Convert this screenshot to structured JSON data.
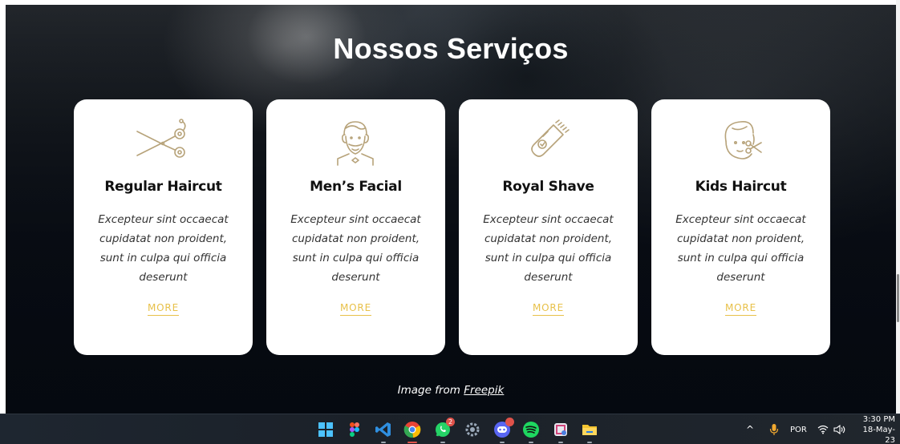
{
  "section": {
    "title": "Nossos Serviços"
  },
  "cards": [
    {
      "icon": "scissors-icon",
      "title": "Regular Haircut",
      "text": "Excepteur sint occaecat cupidatat non proident, sunt in culpa qui officia deserunt",
      "more": "MORE"
    },
    {
      "icon": "bearded-man-icon",
      "title": "Men’s Facial",
      "text": "Excepteur sint occaecat cupidatat non proident, sunt in culpa qui officia deserunt",
      "more": "MORE"
    },
    {
      "icon": "razor-icon",
      "title": "Royal Shave",
      "text": "Excepteur sint occaecat cupidatat non proident, sunt in culpa qui officia deserunt",
      "more": "MORE"
    },
    {
      "icon": "kid-haircut-icon",
      "title": "Kids Haircut",
      "text": "Excepteur sint occaecat cupidatat non proident, sunt in culpa qui officia deserunt",
      "more": "MORE"
    }
  ],
  "credit": {
    "prefix": "Image from",
    "link": "Freepik"
  },
  "colors": {
    "accent": "#e8c14a",
    "icon_stroke": "#b7a37a",
    "card_bg": "#ffffff"
  },
  "taskbar": {
    "apps": [
      {
        "icon": "windows-start-icon"
      },
      {
        "icon": "figma-icon"
      },
      {
        "icon": "vscode-icon"
      },
      {
        "icon": "chrome-icon",
        "active": true
      },
      {
        "icon": "whatsapp-icon",
        "badge": "2"
      },
      {
        "icon": "settings-gear-icon"
      },
      {
        "icon": "discord-icon"
      },
      {
        "icon": "spotify-icon"
      },
      {
        "icon": "snipping-tool-icon"
      },
      {
        "icon": "file-explorer-icon"
      }
    ],
    "tray": {
      "language": "POR",
      "time": "3:30 PM",
      "date": "18-May-23"
    }
  }
}
